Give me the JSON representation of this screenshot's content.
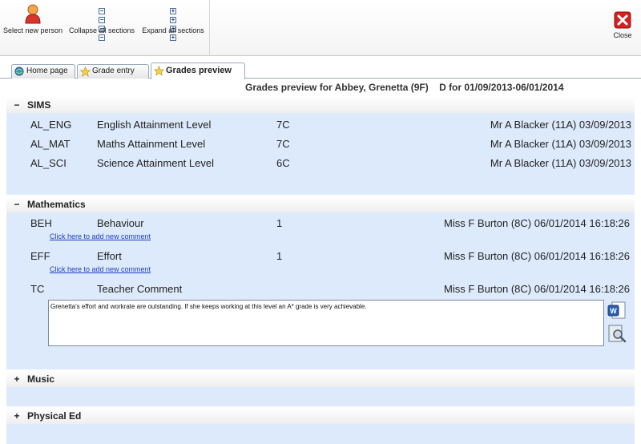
{
  "toolbar": {
    "select_person": "Select new person",
    "collapse_all": "Collapse all sections",
    "expand_all": "Expand all sections",
    "close": "Close"
  },
  "tabs": [
    {
      "label": "Home page",
      "icon": "home-icon"
    },
    {
      "label": "Grade entry",
      "icon": "star-icon"
    },
    {
      "label": "Grades preview",
      "icon": "star-icon",
      "active": true
    }
  ],
  "preview_title": "Grades preview for Abbey, Grenetta (9F)    D for 01/09/2013-06/01/2014",
  "sections": {
    "sims": {
      "name": "SIMS",
      "toggle": "−",
      "rows": [
        {
          "code": "AL_ENG",
          "desc": "English Attainment Level",
          "grade": "7C",
          "by": "Mr A Blacker (11A) 03/09/2013"
        },
        {
          "code": "AL_MAT",
          "desc": "Maths Attainment Level",
          "grade": "7C",
          "by": "Mr A Blacker (11A) 03/09/2013"
        },
        {
          "code": "AL_SCI",
          "desc": "Science Attainment Level",
          "grade": "6C",
          "by": "Mr A Blacker (11A) 03/09/2013"
        }
      ]
    },
    "mathematics": {
      "name": "Mathematics",
      "toggle": "−",
      "rows": [
        {
          "code": "BEH",
          "desc": "Behaviour",
          "grade": "1",
          "by": "Miss F Burton (8C) 06/01/2014 16:18:26",
          "link": "Click here to add new comment"
        },
        {
          "code": "EFF",
          "desc": "Effort",
          "grade": "1",
          "by": "Miss F Burton (8C) 06/01/2014 16:18:26",
          "link": "Click here to add new comment"
        },
        {
          "code": "TC",
          "desc": "Teacher Comment",
          "grade": "",
          "by": "Miss F Burton (8C) 06/01/2014 16:18:26"
        }
      ],
      "comment": "Grenetta's effort and workrate are outstanding. If she keeps working at this level an A* grade is very achievable."
    },
    "music": {
      "name": "Music",
      "toggle": "+"
    },
    "physical_ed": {
      "name": "Physical Ed",
      "toggle": "+"
    }
  },
  "colors": {
    "section_bg": "#ddeafb",
    "link": "#1c3cc2",
    "close_red": "#d42020"
  }
}
